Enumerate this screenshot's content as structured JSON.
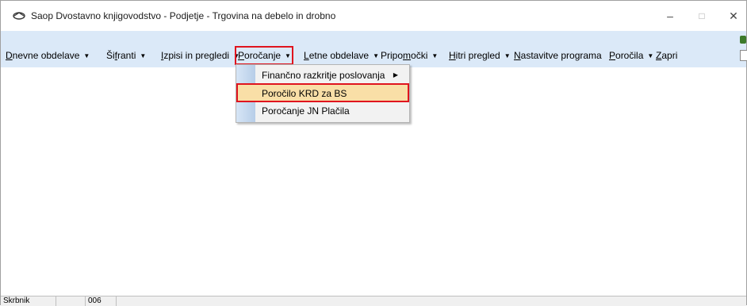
{
  "window": {
    "title": "Saop Dvostavno knjigovodstvo - Podjetje - Trgovina na debelo in drobno",
    "app_icon": "saop-logo-icon",
    "controls": {
      "minimize": "–",
      "maximize": "□",
      "close": "✕"
    }
  },
  "menubar": {
    "items": [
      {
        "pre": "",
        "ul": "D",
        "post": "nevne obdelave",
        "has_arrow": true
      },
      {
        "pre": "Ši",
        "ul": "f",
        "post": "ranti",
        "has_arrow": true
      },
      {
        "pre": "",
        "ul": "I",
        "post": "zpisi in pregledi",
        "has_arrow": true
      },
      {
        "pre": "",
        "ul": "P",
        "post": "oročanje",
        "has_arrow": true
      },
      {
        "pre": "",
        "ul": "L",
        "post": "etne obdelave",
        "has_arrow": true
      },
      {
        "pre": "Pripo",
        "ul": "m",
        "post": "očki",
        "has_arrow": true
      },
      {
        "pre": "",
        "ul": "H",
        "post": "itri pregled",
        "has_arrow": true
      },
      {
        "pre": "",
        "ul": "N",
        "post": "astavitve programa",
        "has_arrow": false
      },
      {
        "pre": "",
        "ul": "P",
        "post": "oročila",
        "has_arrow": true
      },
      {
        "pre": "",
        "ul": "Z",
        "post": "apri",
        "has_arrow": false
      }
    ],
    "arrow_glyph": "▼",
    "highlight_color": "#e0141e"
  },
  "dropdown": {
    "items": [
      {
        "label": "Finančno razkritje poslovanja",
        "submenu": true,
        "submenu_glyph": "▶"
      },
      {
        "label": "Poročilo KRD za BS",
        "submenu": false
      },
      {
        "label": "Poročanje JN Plačila",
        "submenu": false
      }
    ]
  },
  "statusbar": {
    "user_label": "Skrbnik",
    "code": "006"
  }
}
